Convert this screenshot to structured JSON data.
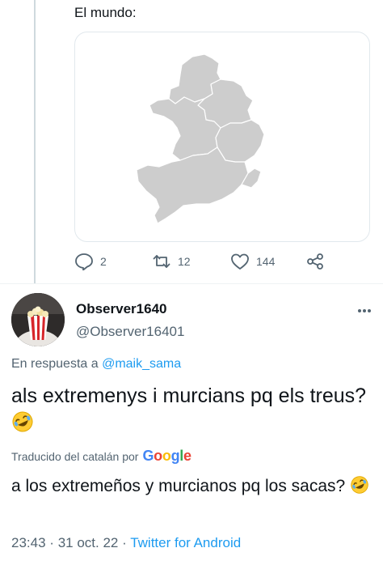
{
  "quoted": {
    "text": "El mundo:",
    "stats": {
      "replies": "2",
      "retweets": "12",
      "likes": "144"
    }
  },
  "reply": {
    "display_name": "Observer1640",
    "handle": "@Observer16401",
    "reply_prefix": "En respuesta a",
    "reply_mention": "@maik_sama",
    "text": "als extremenys i murcians pq els treus?",
    "emoji": "rolling-on-floor-laughing",
    "translated_label": "Traducido del catalán por",
    "translated_brand": "Google",
    "translation": "a los extremeños y murcianos pq los sacas?",
    "time": "23:43",
    "date": "31 oct. 22",
    "source": "Twitter for Android",
    "separator": "·"
  },
  "colors": {
    "link": "#1d9bf0",
    "secondary": "#536471",
    "map_fill": "#cfcfcf",
    "google_blue": "#4285F4",
    "google_red": "#EA4335",
    "google_yellow": "#FBBC05",
    "google_green": "#34A853"
  },
  "icons": [
    "reply-icon",
    "retweet-icon",
    "like-icon",
    "share-icon",
    "more-icon",
    "google-logo",
    "laugh-emoji-icon"
  ]
}
